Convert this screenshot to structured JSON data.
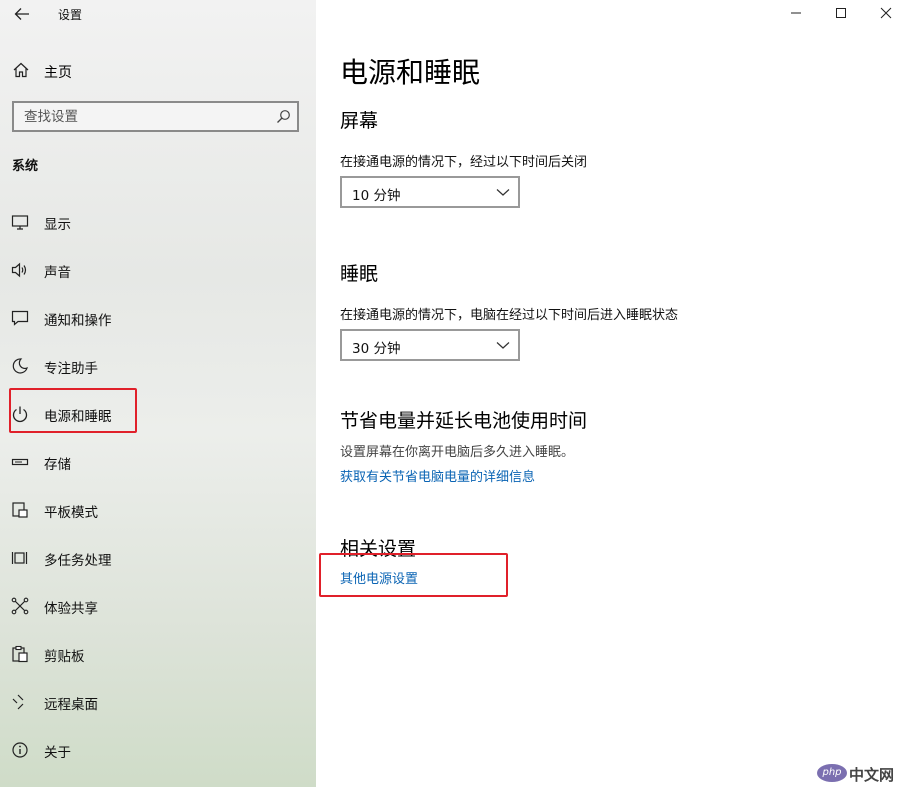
{
  "window": {
    "title": "设置",
    "controls": [
      "minimize-icon",
      "maximize-icon",
      "close-icon"
    ]
  },
  "sidebar": {
    "home_label": "主页",
    "search_placeholder": "查找设置",
    "section_label": "系统",
    "items": [
      {
        "label": "显示",
        "icon": "display-icon"
      },
      {
        "label": "声音",
        "icon": "speaker-icon"
      },
      {
        "label": "通知和操作",
        "icon": "notification-icon"
      },
      {
        "label": "专注助手",
        "icon": "moon-icon"
      },
      {
        "label": "电源和睡眠",
        "icon": "power-icon",
        "selected": true
      },
      {
        "label": "存储",
        "icon": "storage-icon"
      },
      {
        "label": "平板模式",
        "icon": "tablet-icon"
      },
      {
        "label": "多任务处理",
        "icon": "multitask-icon"
      },
      {
        "label": "体验共享",
        "icon": "share-icon"
      },
      {
        "label": "剪贴板",
        "icon": "clipboard-icon"
      },
      {
        "label": "远程桌面",
        "icon": "remote-desktop-icon"
      },
      {
        "label": "关于",
        "icon": "info-icon"
      }
    ]
  },
  "main": {
    "title": "电源和睡眠",
    "screen": {
      "heading": "屏幕",
      "description": "在接通电源的情况下，经过以下时间后关闭",
      "value": "10 分钟"
    },
    "sleep": {
      "heading": "睡眠",
      "description": "在接通电源的情况下，电脑在经过以下时间后进入睡眠状态",
      "value": "30 分钟"
    },
    "battery": {
      "heading": "节省电量并延长电池使用时间",
      "description": "设置屏幕在你离开电脑后多久进入睡眠。",
      "link": "获取有关节省电脑电量的详细信息"
    },
    "related": {
      "heading": "相关设置",
      "link": "其他电源设置"
    }
  },
  "watermark": {
    "badge": "php",
    "text": "中文网"
  },
  "colors": {
    "link": "#0a64b4",
    "highlight_box": "#e0202a"
  }
}
